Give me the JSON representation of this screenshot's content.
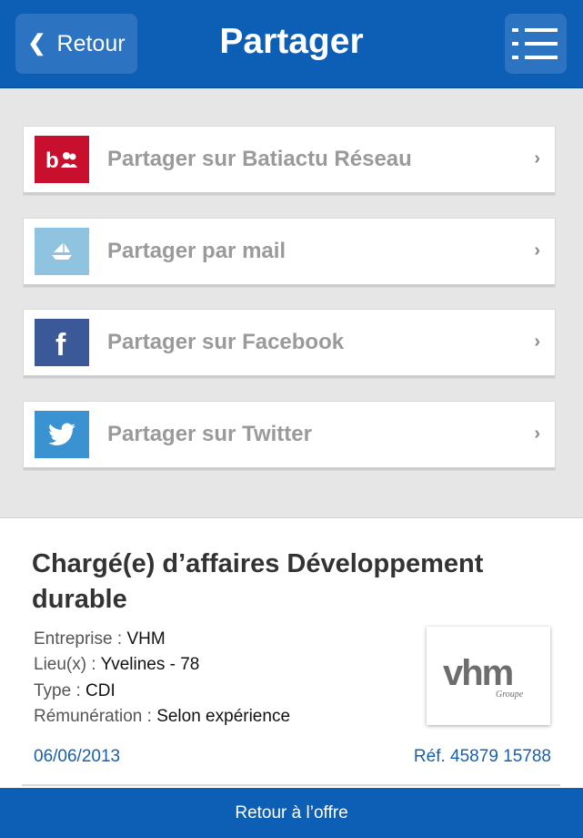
{
  "header": {
    "back_label": "Retour",
    "title": "Partager"
  },
  "share": {
    "items": [
      {
        "label": "Partager sur Batiactu Réseau",
        "icon": "batiactu-icon",
        "color": "#c8102e"
      },
      {
        "label": "Partager par mail",
        "icon": "mail-icon",
        "color": "#8fc3e0"
      },
      {
        "label": "Partager sur Facebook",
        "icon": "facebook-icon",
        "color": "#3b5998"
      },
      {
        "label": "Partager sur Twitter",
        "icon": "twitter-icon",
        "color": "#3a92d0"
      }
    ]
  },
  "offer": {
    "title": "Chargé(e) d’affaires Développement durable",
    "company_label": "Entreprise :",
    "company_value": "VHM",
    "location_label": "Lieu(x) :",
    "location_value": "Yvelines - 78",
    "type_label": "Type :",
    "type_value": "CDI",
    "salary_label": "Rémunération :",
    "salary_value": "Selon expérience",
    "date": "06/06/2013",
    "ref": "Réf. 45879 15788",
    "logo_text": "vhm",
    "logo_subtext": "Groupe"
  },
  "footer": {
    "back_to_offer": "Retour à l’offre"
  },
  "colors": {
    "primary": "#0d5eb5",
    "link": "#1a5fab"
  }
}
